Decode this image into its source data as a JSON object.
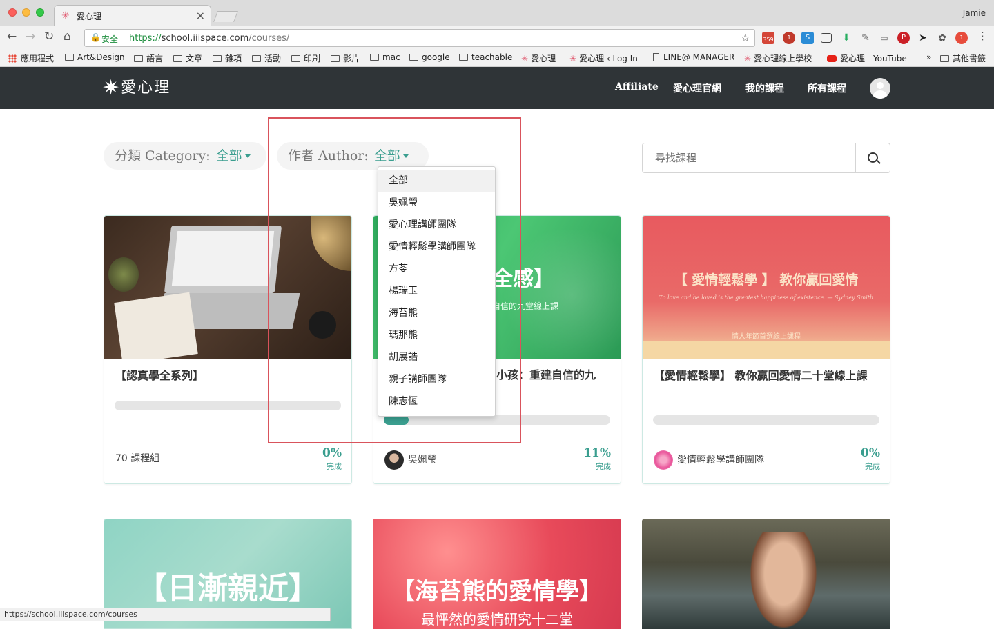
{
  "browser": {
    "tab_title": "愛心理",
    "profile": "Jamie",
    "secure_label": "安全",
    "url_scheme": "https://",
    "url_host": "school.iiispace.com",
    "url_path": "/courses/",
    "status_url": "https://school.iiispace.com/courses",
    "bookmarks": [
      {
        "label": "應用程式",
        "icon": "apps-grid-icon"
      },
      {
        "label": "Art&Design",
        "icon": "folder-icon"
      },
      {
        "label": "語言",
        "icon": "folder-icon"
      },
      {
        "label": "文章",
        "icon": "folder-icon"
      },
      {
        "label": "雜項",
        "icon": "folder-icon"
      },
      {
        "label": "活動",
        "icon": "folder-icon"
      },
      {
        "label": "印刷",
        "icon": "folder-icon"
      },
      {
        "label": "影片",
        "icon": "folder-icon"
      },
      {
        "label": "mac",
        "icon": "folder-icon"
      },
      {
        "label": "google",
        "icon": "folder-icon"
      },
      {
        "label": "teachable",
        "icon": "folder-icon"
      },
      {
        "label": "愛心理",
        "icon": "iiispace-icon"
      },
      {
        "label": "愛心理 ‹ Log In",
        "icon": "iiispace-icon"
      },
      {
        "label": "LINE@ MANAGER",
        "icon": "document-icon"
      },
      {
        "label": "愛心理線上學校",
        "icon": "iiispace-icon"
      },
      {
        "label": "愛心理 - YouTube",
        "icon": "youtube-icon"
      }
    ],
    "bookmarks_overflow": "»",
    "other_bookmarks": "其他書籤",
    "ext_badges": {
      "mail": "359",
      "abp": "1",
      "gs": "1"
    }
  },
  "site": {
    "logo_text": "愛心理",
    "nav": [
      "Affiliate",
      "愛心理官網",
      "我的課程",
      "所有課程"
    ]
  },
  "filters": {
    "category_label": "分類 Category:",
    "category_value": "全部",
    "author_label": "作者 Author:",
    "author_value": "全部",
    "search_placeholder": "尋找課程"
  },
  "author_dropdown": {
    "options": [
      "全部",
      "吳姵瑩",
      "愛心理講師團隊",
      "愛情輕鬆學講師團隊",
      "方苓",
      "楊瑞玉",
      "海苔熊",
      "瑪那熊",
      "胡展誥",
      "親子講師團隊",
      "陳志恆"
    ],
    "selected_index": 0
  },
  "courses": [
    {
      "title": "【認真學全系列】",
      "author": "70 課程組",
      "progress": 0,
      "percent": "0%",
      "done_label": "完成"
    },
    {
      "title": "小孩：重建自信的九",
      "author": "吳姵瑩",
      "progress": 11,
      "percent": "11%",
      "done_label": "完成",
      "img_text": "全感】",
      "img_sub": "建自信的九堂線上課"
    },
    {
      "title": "【愛情輕鬆學】 教你贏回愛情二十堂線上課",
      "author": "愛情輕鬆學講師團隊",
      "progress": 0,
      "percent": "0%",
      "done_label": "完成",
      "img_text": "【 愛情輕鬆學 】 教你贏回愛情",
      "img_sub": "To love and be loved is the greatest happiness of existence. — Sydney Smith",
      "img_sub2": "情人年節首選線上課程"
    }
  ],
  "courses_row2": [
    {
      "img_text": "【日漸親近】"
    },
    {
      "img_text": "【海苔熊的愛情學】",
      "img_sub": "最怦然的愛情研究十二堂"
    },
    {
      "img_text": ""
    }
  ],
  "colors": {
    "accent": "#3a9e8f",
    "header_bg": "#2f3437",
    "highlight": "#d9535c"
  }
}
